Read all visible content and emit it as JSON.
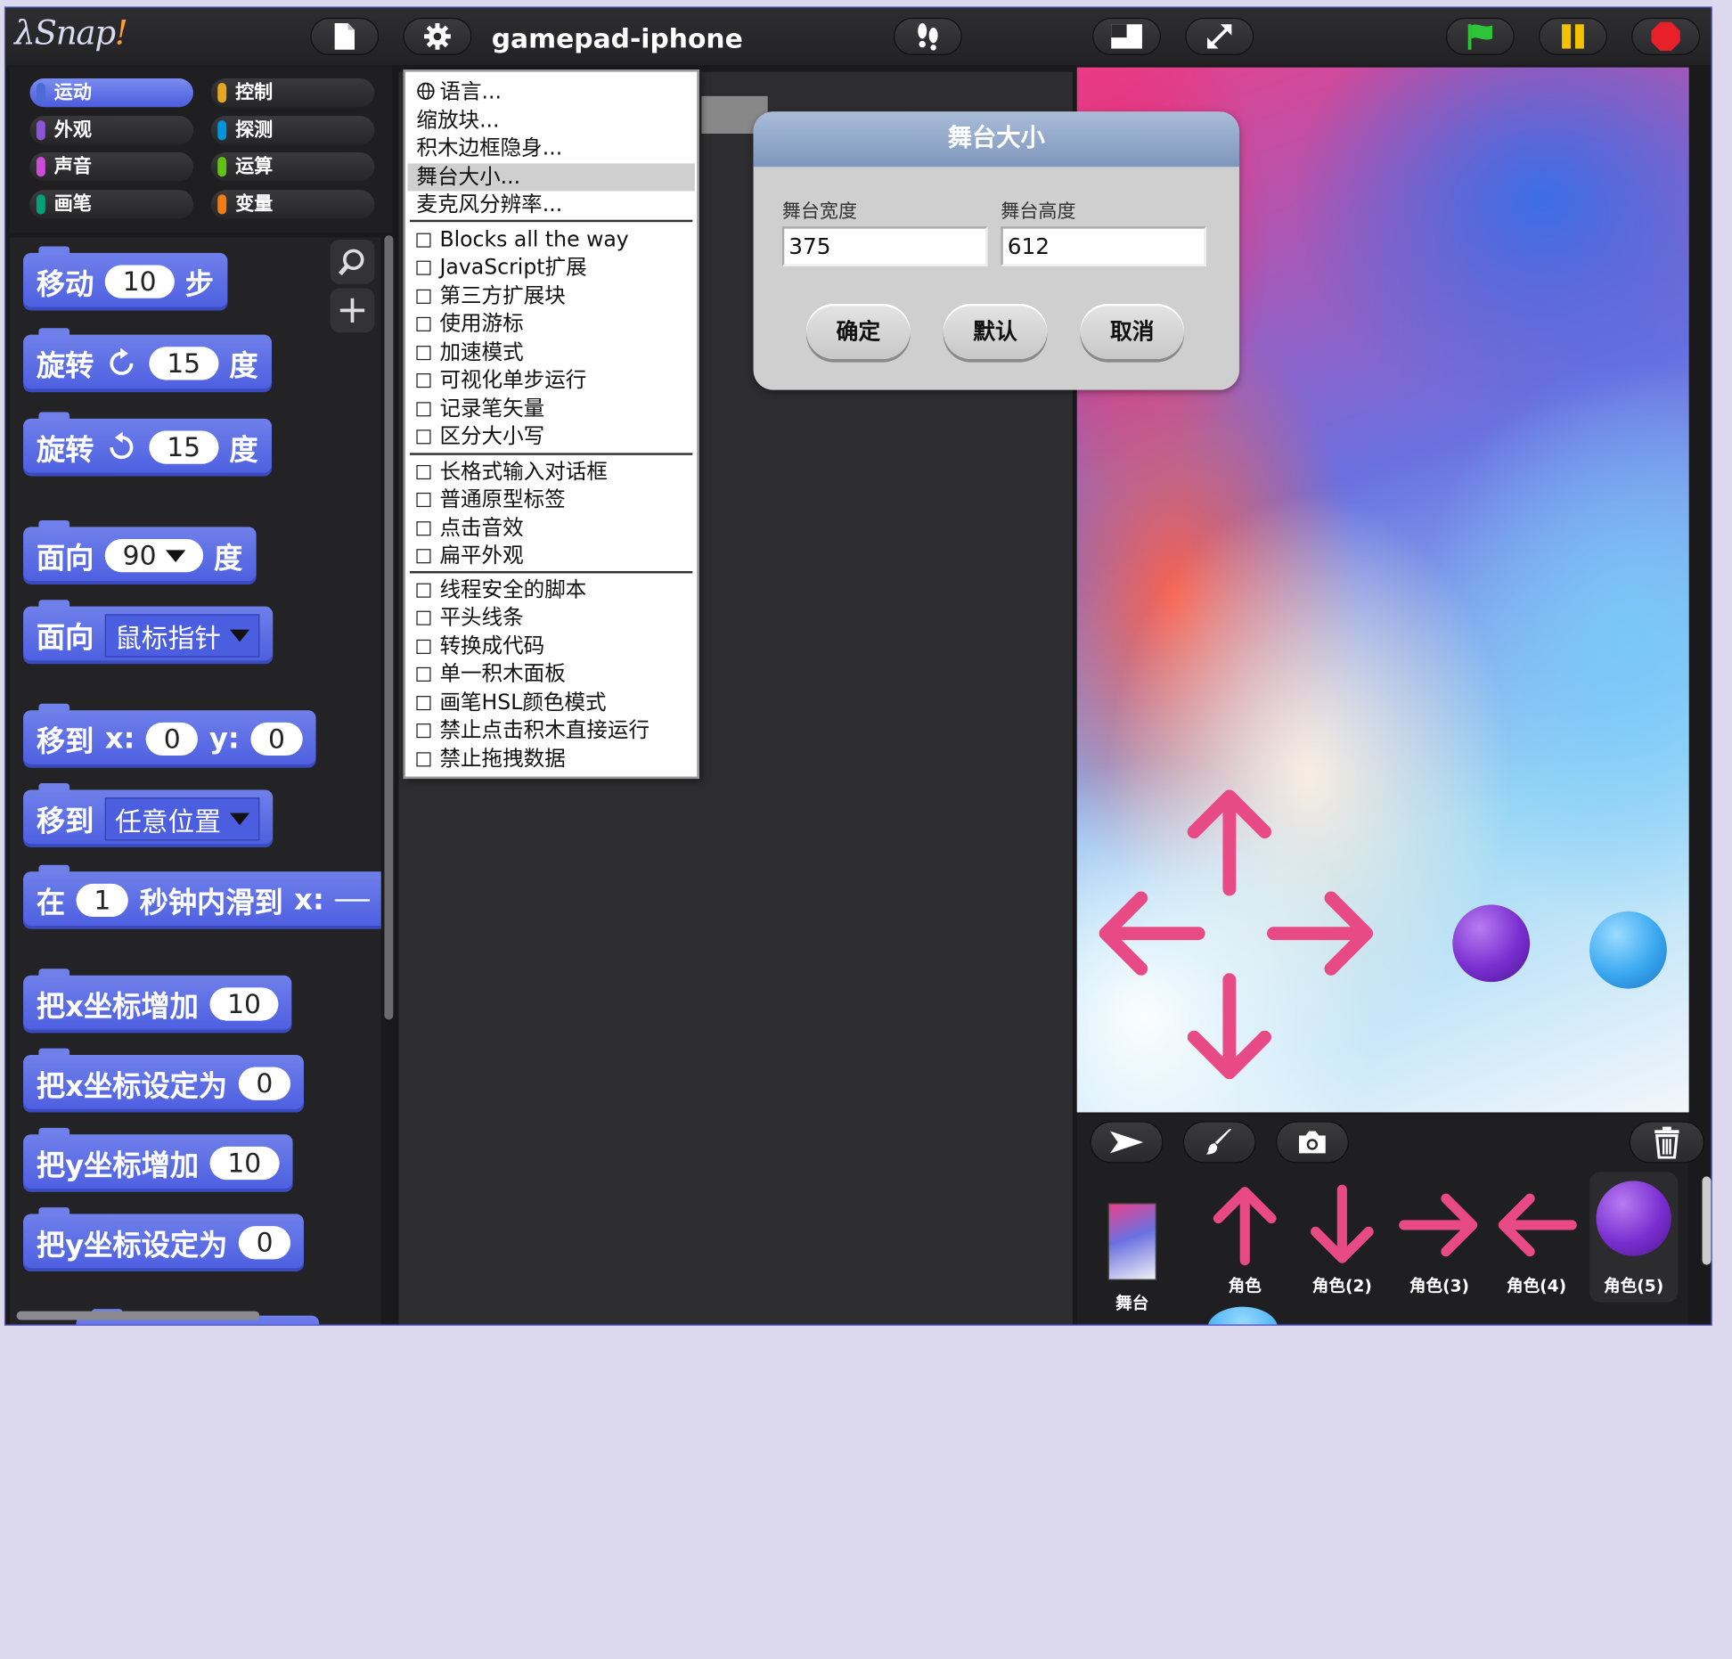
{
  "app": {
    "logo_prefix": "λ",
    "logo_word": "Snap",
    "logo_bang": "!",
    "project_title": "gamepad-iphone"
  },
  "categories": [
    {
      "label": "运动",
      "color": "#4a6cd4",
      "active": true
    },
    {
      "label": "控制",
      "color": "#e6a822"
    },
    {
      "label": "外观",
      "color": "#8a55d7"
    },
    {
      "label": "探测",
      "color": "#0494dc"
    },
    {
      "label": "声音",
      "color": "#cf4ad9"
    },
    {
      "label": "运算",
      "color": "#62c213"
    },
    {
      "label": "画笔",
      "color": "#00a178"
    },
    {
      "label": "变量",
      "color": "#ee7d16"
    }
  ],
  "blocks": {
    "move": {
      "pre": "移动",
      "val": "10",
      "post": "步"
    },
    "turn_cw": {
      "pre": "旋转",
      "val": "15",
      "post": "度"
    },
    "turn_ccw": {
      "pre": "旋转",
      "val": "15",
      "post": "度"
    },
    "point_dir": {
      "pre": "面向",
      "val": "90",
      "post": "度"
    },
    "point_towards": {
      "pre": "面向",
      "val": "鼠标指针"
    },
    "goto_xy": {
      "pre": "移到",
      "x": "x:",
      "xval": "0",
      "y": "y:",
      "yval": "0"
    },
    "goto": {
      "pre": "移到",
      "val": "任意位置"
    },
    "glide": {
      "pre": "在",
      "val": "1",
      "post": "秒钟内滑到",
      "x": "x:"
    },
    "change_x": {
      "pre": "把x坐标增加",
      "val": "10"
    },
    "set_x": {
      "pre": "把x坐标设定为",
      "val": "0"
    },
    "change_y": {
      "pre": "把y坐标增加",
      "val": "10"
    },
    "set_y": {
      "pre": "把y坐标设定为",
      "val": "0"
    }
  },
  "menu": {
    "items_top": [
      "语言...",
      "缩放块...",
      "积木边框隐身...",
      "舞台大小...",
      "麦克风分辨率..."
    ],
    "group1": [
      "Blocks all the way",
      "JavaScript扩展",
      "第三方扩展块",
      "使用游标",
      "加速模式",
      "可视化单步运行",
      "记录笔矢量",
      "区分大小写"
    ],
    "group2": [
      "长格式输入对话框",
      "普通原型标签",
      "点击音效",
      "扁平外观"
    ],
    "group3": [
      "线程安全的脚本",
      "平头线条",
      "转换成代码",
      "单一积木面板",
      "画笔HSL颜色模式",
      "禁止点击积木直接运行",
      "禁止拖拽数据"
    ]
  },
  "dialog": {
    "title": "舞台大小",
    "width_label": "舞台宽度",
    "width_value": "375",
    "height_label": "舞台高度",
    "height_value": "612",
    "ok": "确定",
    "default": "默认",
    "cancel": "取消"
  },
  "corral": {
    "stage_label": "舞台",
    "sprites": [
      "角色",
      "角色(2)",
      "角色(3)",
      "角色(4)",
      "角色(5)"
    ]
  },
  "colors": {
    "accent": "#4c5ee0",
    "arrow": "#e84a86",
    "purple_ball": "#7a2ed0",
    "blue_ball": "#3aa8f0",
    "go_flag": "#2ec43a",
    "pause": "#f2c200",
    "stop": "#e8202a"
  },
  "icons": [
    "file-icon",
    "gear-icon",
    "footprints-icon",
    "stage-size-icon",
    "fullscreen-icon",
    "green-flag-icon",
    "pause-icon",
    "stop-icon",
    "search-icon",
    "zoom-plus-icon",
    "globe-icon",
    "arrow-tool-icon",
    "paintbrush-icon",
    "camera-icon",
    "trash-icon"
  ]
}
